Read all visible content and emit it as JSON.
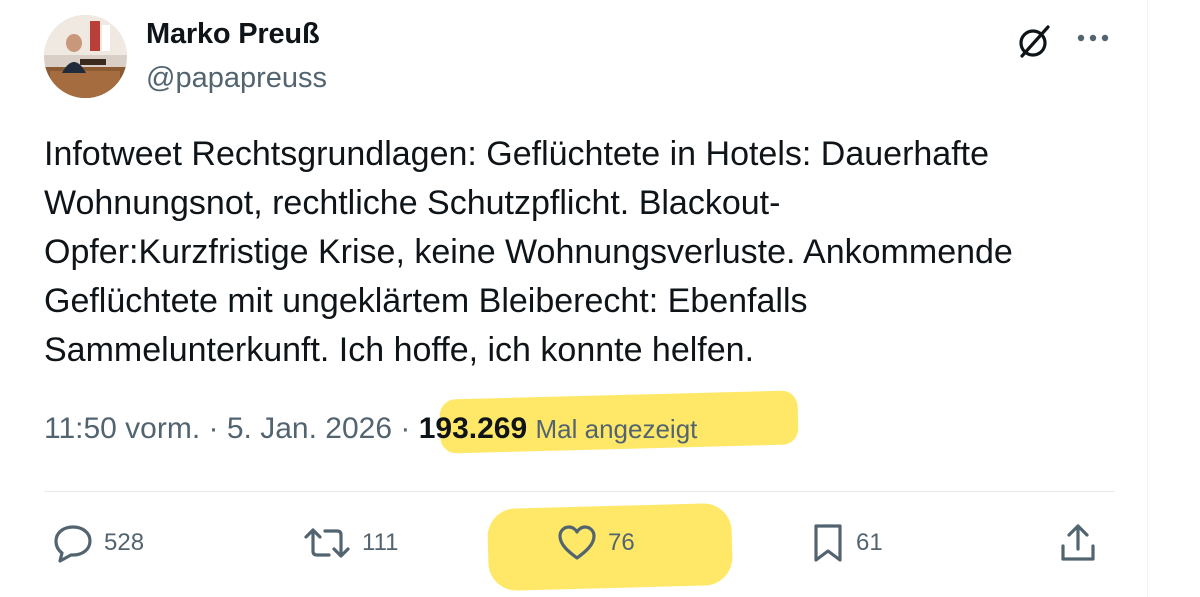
{
  "author": {
    "name": "Marko Preuß",
    "handle": "@papapreuss"
  },
  "tweet": {
    "text": "Infotweet Rechtsgrundlagen: Geflüchtete in Hotels: Dauerhafte\nWohnungsnot, rechtliche Schutzpflicht. Blackout-\nOpfer:Kurzfristige Krise, keine Wohnungsverluste. Ankommende\nGeflüchtete mit ungeklärtem Bleiberecht: Ebenfalls\nSammelunterkunft. Ich hoffe, ich konnte helfen.",
    "time": "11:50 vorm.",
    "separator": "·",
    "date": "5. Jan. 2026",
    "views_count": "193.269",
    "views_label": "Mal angezeigt"
  },
  "actions": {
    "replies": "528",
    "reposts": "111",
    "likes": "76",
    "bookmarks": "61"
  },
  "icons": [
    "grok-icon",
    "more-icon",
    "reply-icon",
    "repost-icon",
    "like-icon",
    "bookmark-icon",
    "share-icon"
  ],
  "colors": {
    "text": "#0f1419",
    "secondary": "#536471",
    "highlight": "#ffe44d",
    "divider": "#e7e9ea"
  }
}
